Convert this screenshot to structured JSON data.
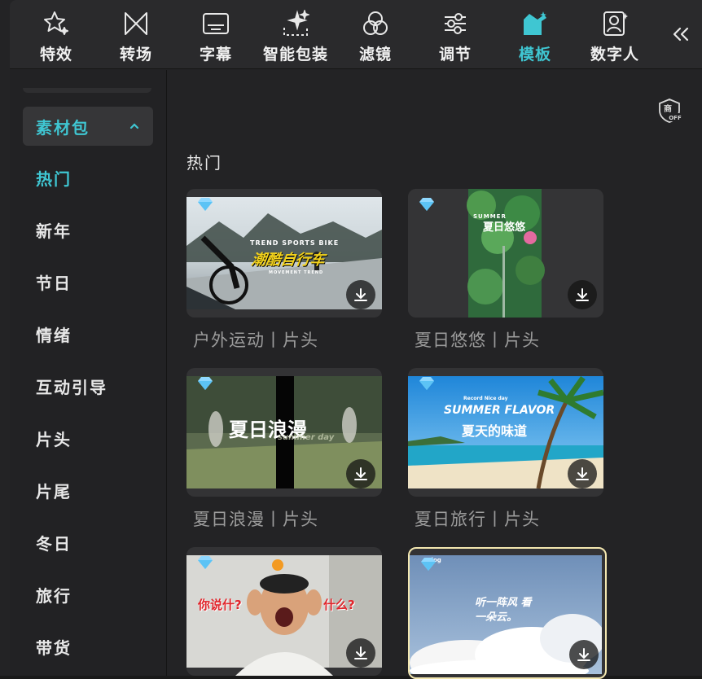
{
  "toolbar": {
    "items": [
      {
        "label": "特效",
        "icon": "star-sparkle-icon"
      },
      {
        "label": "转场",
        "icon": "bowtie-transition-icon"
      },
      {
        "label": "字幕",
        "icon": "subtitle-icon"
      },
      {
        "label": "智能包装",
        "icon": "magic-package-icon"
      },
      {
        "label": "滤镜",
        "icon": "filter-circles-icon"
      },
      {
        "label": "调节",
        "icon": "sliders-icon"
      },
      {
        "label": "模板",
        "icon": "template-box-icon"
      },
      {
        "label": "数字人",
        "icon": "digital-human-icon"
      }
    ],
    "active_index": 6,
    "collapse_icon": "double-chevron-left-icon",
    "accent_color": "#3fc6d2"
  },
  "sidebar": {
    "group": {
      "label": "素材包",
      "expanded": true
    },
    "items": [
      "热门",
      "新年",
      "节日",
      "情绪",
      "互动引导",
      "片头",
      "片尾",
      "冬日",
      "旅行",
      "带货"
    ],
    "active_index": 0
  },
  "main": {
    "copyright_badge": {
      "top": "商",
      "bottom": "OFF"
    },
    "section_title": "热门",
    "cards": [
      {
        "caption": "户外运动丨片头",
        "overlay_en": "TREND SPORTS BIKE",
        "overlay_cn": "潮酷自行车",
        "sub": "MOVEMENT TREND",
        "premium": true
      },
      {
        "caption": "夏日悠悠丨片头",
        "overlay_en": "SUMMER",
        "overlay_cn": "夏日悠悠",
        "premium": true
      },
      {
        "caption": "夏日浪漫丨片头",
        "overlay_cn": "夏日浪漫",
        "overlay_script": "summer day",
        "premium": true
      },
      {
        "caption": "夏日旅行丨片头",
        "overlay_en": "SUMMER FLAVOR",
        "overlay_cn": "夏天的味道",
        "overlay_small": "Record Nice day",
        "premium": true
      },
      {
        "caption": "",
        "overlay_left": "你说什?",
        "overlay_right": "什么?",
        "premium": true
      },
      {
        "caption": "",
        "overlay_cn": "听一阵风 看一朵云。",
        "overlay_small": "vlog",
        "premium": true
      }
    ]
  }
}
